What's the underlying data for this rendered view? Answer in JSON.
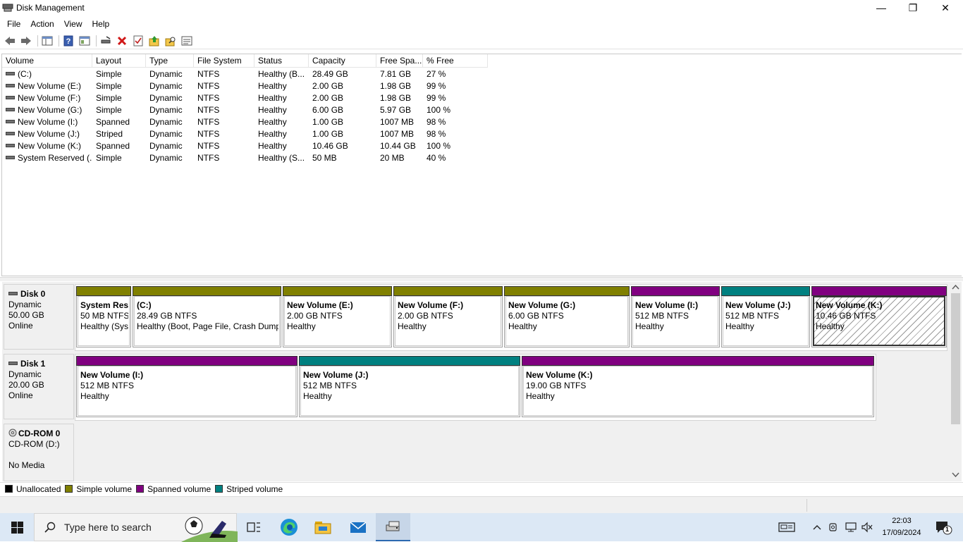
{
  "window": {
    "title": "Disk Management",
    "minimize": "—",
    "restore": "❐",
    "close": "✕"
  },
  "menu": [
    "File",
    "Action",
    "View",
    "Help"
  ],
  "table": {
    "columns": [
      "Volume",
      "Layout",
      "Type",
      "File System",
      "Status",
      "Capacity",
      "Free Spa...",
      "% Free"
    ],
    "rows": [
      [
        "(C:)",
        "Simple",
        "Dynamic",
        "NTFS",
        "Healthy (B...",
        "28.49 GB",
        "7.81 GB",
        "27 %"
      ],
      [
        "New Volume (E:)",
        "Simple",
        "Dynamic",
        "NTFS",
        "Healthy",
        "2.00 GB",
        "1.98 GB",
        "99 %"
      ],
      [
        "New Volume (F:)",
        "Simple",
        "Dynamic",
        "NTFS",
        "Healthy",
        "2.00 GB",
        "1.98 GB",
        "99 %"
      ],
      [
        "New Volume (G:)",
        "Simple",
        "Dynamic",
        "NTFS",
        "Healthy",
        "6.00 GB",
        "5.97 GB",
        "100 %"
      ],
      [
        "New Volume (I:)",
        "Spanned",
        "Dynamic",
        "NTFS",
        "Healthy",
        "1.00 GB",
        "1007 MB",
        "98 %"
      ],
      [
        "New Volume (J:)",
        "Striped",
        "Dynamic",
        "NTFS",
        "Healthy",
        "1.00 GB",
        "1007 MB",
        "98 %"
      ],
      [
        "New Volume (K:)",
        "Spanned",
        "Dynamic",
        "NTFS",
        "Healthy",
        "10.46 GB",
        "10.44 GB",
        "100 %"
      ],
      [
        "System Reserved (...",
        "Simple",
        "Dynamic",
        "NTFS",
        "Healthy (S...",
        "50 MB",
        "20 MB",
        "40 %"
      ]
    ]
  },
  "colors": {
    "simple": "#808000",
    "spanned": "#800080",
    "striped": "#008080",
    "unallocated": "#000000"
  },
  "disks": [
    {
      "name": "Disk 0",
      "type": "Dynamic",
      "size": "50.00 GB",
      "state": "Online",
      "partitions": [
        {
          "title": "System Res",
          "size": "50 MB NTFS",
          "status": "Healthy (Sys",
          "kind": "simple"
        },
        {
          "title": "(C:)",
          "size": "28.49 GB NTFS",
          "status": "Healthy (Boot, Page File, Crash Dump",
          "kind": "simple"
        },
        {
          "title": "New Volume  (E:)",
          "size": "2.00 GB NTFS",
          "status": "Healthy",
          "kind": "simple"
        },
        {
          "title": "New Volume  (F:)",
          "size": "2.00 GB NTFS",
          "status": "Healthy",
          "kind": "simple"
        },
        {
          "title": "New Volume  (G:)",
          "size": "6.00 GB NTFS",
          "status": "Healthy",
          "kind": "simple"
        },
        {
          "title": "New Volume  (I:)",
          "size": "512 MB NTFS",
          "status": "Healthy",
          "kind": "spanned"
        },
        {
          "title": "New Volume  (J:)",
          "size": "512 MB NTFS",
          "status": "Healthy",
          "kind": "striped"
        },
        {
          "title": "New Volume  (K:)",
          "size": "10.46 GB NTFS",
          "status": "Healthy",
          "kind": "spanned"
        }
      ]
    },
    {
      "name": "Disk 1",
      "type": "Dynamic",
      "size": "20.00 GB",
      "state": "Online",
      "partitions": [
        {
          "title": "New Volume  (I:)",
          "size": "512 MB NTFS",
          "status": "Healthy",
          "kind": "spanned"
        },
        {
          "title": "New Volume  (J:)",
          "size": "512 MB NTFS",
          "status": "Healthy",
          "kind": "striped"
        },
        {
          "title": "New Volume  (K:)",
          "size": "19.00 GB NTFS",
          "status": "Healthy",
          "kind": "spanned"
        }
      ]
    },
    {
      "name": "CD-ROM 0",
      "type": "CD-ROM (D:)",
      "size": "",
      "state": "No Media"
    }
  ],
  "legend": [
    "Unallocated",
    "Simple volume",
    "Spanned volume",
    "Striped volume"
  ],
  "taskbar": {
    "search_placeholder": "Type here to search",
    "time": "22:03",
    "date": "17/09/2024",
    "notification_count": "1"
  }
}
